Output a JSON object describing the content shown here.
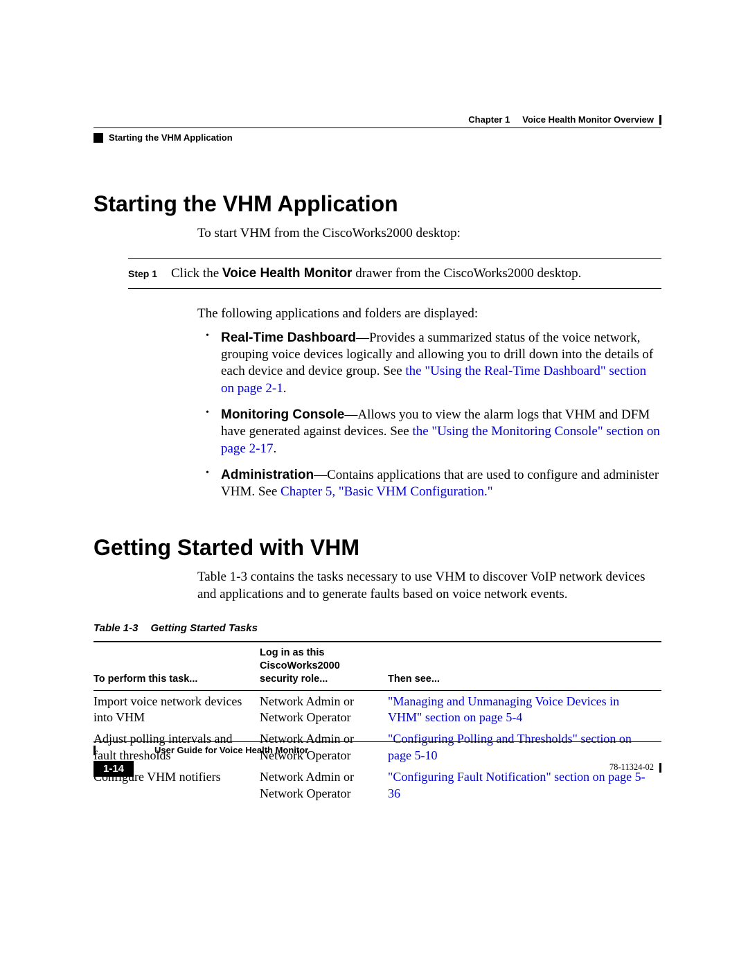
{
  "header": {
    "section": "Starting the VHM Application",
    "chapter": "Chapter 1",
    "chapterTitle": "Voice Health Monitor Overview"
  },
  "section1": {
    "heading": "Starting the VHM Application",
    "intro": "To start VHM from the CiscoWorks2000 desktop:",
    "stepLabel": "Step 1",
    "stepTextA": "Click the ",
    "stepBold": "Voice Health Monitor",
    "stepTextB": " drawer from the CiscoWorks2000 desktop.",
    "afterStep": "The following applications and folders are displayed:",
    "bullets": [
      {
        "boldLead": "Real-Time Dashboard",
        "text1": "—Provides a summarized status of the voice network, grouping voice devices logically and allowing you to drill down into the details of each device and device group. See ",
        "link": "the \"Using the Real-Time Dashboard\" section on page 2-1",
        "text2": "."
      },
      {
        "boldLead": "Monitoring Console",
        "text1": "—Allows you to view the alarm logs that VHM and DFM have generated against devices. See ",
        "link": "the \"Using the Monitoring Console\" section on page 2-17",
        "text2": "."
      },
      {
        "boldLead": "Administration",
        "text1": "—Contains applications that are used to configure and administer VHM. See ",
        "link": "Chapter 5, \"Basic VHM Configuration.\"",
        "text2": ""
      }
    ]
  },
  "section2": {
    "heading": "Getting Started with VHM",
    "intro": "Table 1-3 contains the tasks necessary to use VHM to discover VoIP network devices and applications and to generate faults based on voice network events.",
    "tableCaptionNum": "Table 1-3",
    "tableCaptionTitle": "Getting Started Tasks",
    "headers": {
      "c1": "To perform this task...",
      "c2a": "Log in as this",
      "c2b": "CiscoWorks2000",
      "c2c": "security role...",
      "c3": "Then see..."
    },
    "rows": [
      {
        "task": "Import voice network devices into VHM",
        "role": "Network Admin or Network Operator",
        "see": "\"Managing and Unmanaging Voice Devices in VHM\" section on page 5-4"
      },
      {
        "task": "Adjust polling intervals and fault thresholds",
        "role": "Network Admin or Network Operator",
        "see": "\"Configuring Polling and Thresholds\" section on page 5-10"
      },
      {
        "task": "Configure VHM notifiers",
        "role": "Network Admin or Network Operator",
        "see": "\"Configuring Fault Notification\" section on page 5-36"
      }
    ]
  },
  "footer": {
    "guide": "User Guide for Voice Health Monitor",
    "pageNum": "1-14",
    "docNum": "78-11324-02"
  }
}
